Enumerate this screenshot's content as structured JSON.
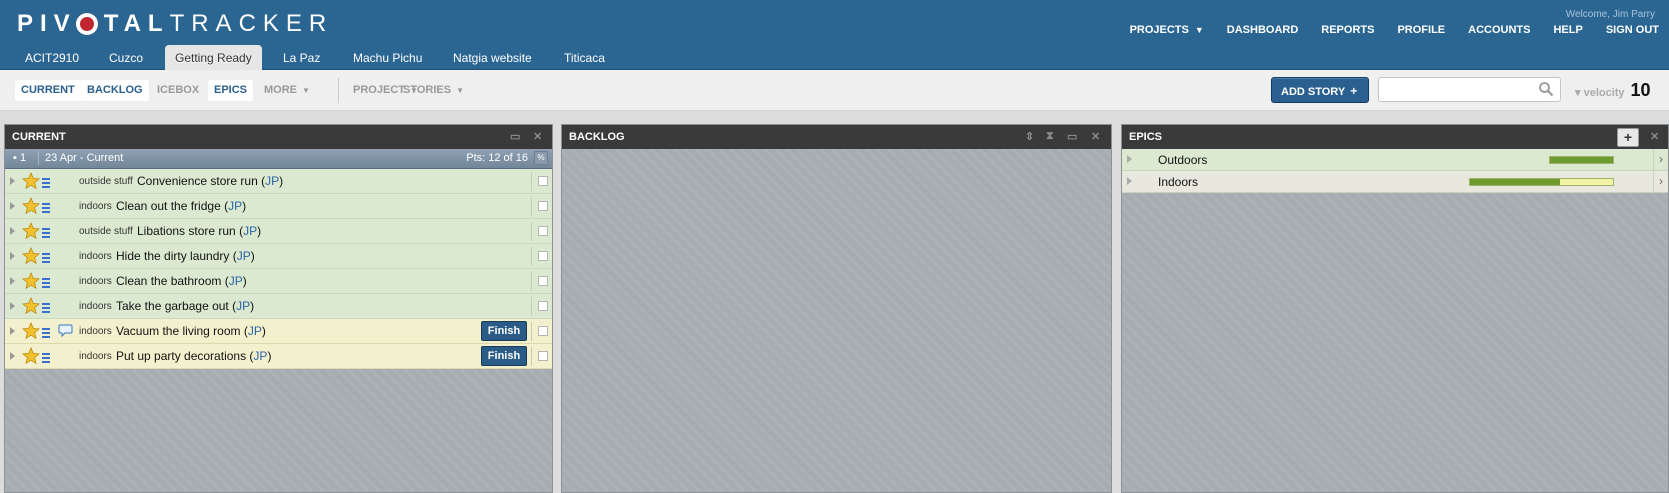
{
  "app": {
    "logo_left": "PIV",
    "logo_right_bold": "TAL",
    "logo_thin": "TRACKER",
    "welcome": "Welcome, Jim Parry"
  },
  "topnav": {
    "projects": "PROJECTS",
    "dashboard": "DASHBOARD",
    "reports": "REPORTS",
    "profile": "PROFILE",
    "accounts": "ACCOUNTS",
    "help": "HELP",
    "signout": "SIGN OUT"
  },
  "project_tabs": [
    "ACIT2910",
    "Cuzco",
    "Getting Ready",
    "La Paz",
    "Machu Pichu",
    "Natgia website",
    "Titicaca"
  ],
  "active_project": "Getting Ready",
  "toolbar": {
    "current": "CURRENT",
    "backlog": "BACKLOG",
    "icebox": "ICEBOX",
    "epics": "EPICS",
    "more": "MORE",
    "project": "PROJECT",
    "stories": "STORIES",
    "add_story": "ADD STORY",
    "search_placeholder": "",
    "velocity_label": "velocity",
    "velocity_value": "10"
  },
  "panels": {
    "current": {
      "title": "CURRENT",
      "iteration": {
        "number": "1",
        "date": "23 Apr - Current",
        "points": "Pts: 12 of 16",
        "pct": "%"
      },
      "stories": [
        {
          "label": "outside stuff",
          "title": "Convenience store run",
          "owner": "JP",
          "state": "accepted",
          "has_comment": false,
          "finish": ""
        },
        {
          "label": "indoors",
          "title": "Clean out the fridge",
          "owner": "JP",
          "state": "accepted",
          "has_comment": false,
          "finish": ""
        },
        {
          "label": "outside stuff",
          "title": "Libations store run",
          "owner": "JP",
          "state": "accepted",
          "has_comment": false,
          "finish": ""
        },
        {
          "label": "indoors",
          "title": "Hide the dirty laundry",
          "owner": "JP",
          "state": "accepted",
          "has_comment": false,
          "finish": ""
        },
        {
          "label": "indoors",
          "title": "Clean the bathroom",
          "owner": "JP",
          "state": "accepted",
          "has_comment": false,
          "finish": ""
        },
        {
          "label": "indoors",
          "title": "Take the garbage out",
          "owner": "JP",
          "state": "accepted",
          "has_comment": false,
          "finish": ""
        },
        {
          "label": "indoors",
          "title": "Vacuum the living room",
          "owner": "JP",
          "state": "started",
          "has_comment": true,
          "finish": "Finish"
        },
        {
          "label": "indoors",
          "title": "Put up party decorations",
          "owner": "JP",
          "state": "started",
          "has_comment": false,
          "finish": "Finish"
        }
      ]
    },
    "backlog": {
      "title": "BACKLOG"
    },
    "epics": {
      "title": "EPICS",
      "items": [
        {
          "name": "Outdoors",
          "progress": 1.0
        },
        {
          "name": "Indoors",
          "progress": 0.63
        }
      ]
    }
  },
  "colors": {
    "header": "#2b6692",
    "accepted_row": "#dbe9d1",
    "started_row": "#f3f1cd",
    "progress_fill": "#6e9a2f"
  }
}
